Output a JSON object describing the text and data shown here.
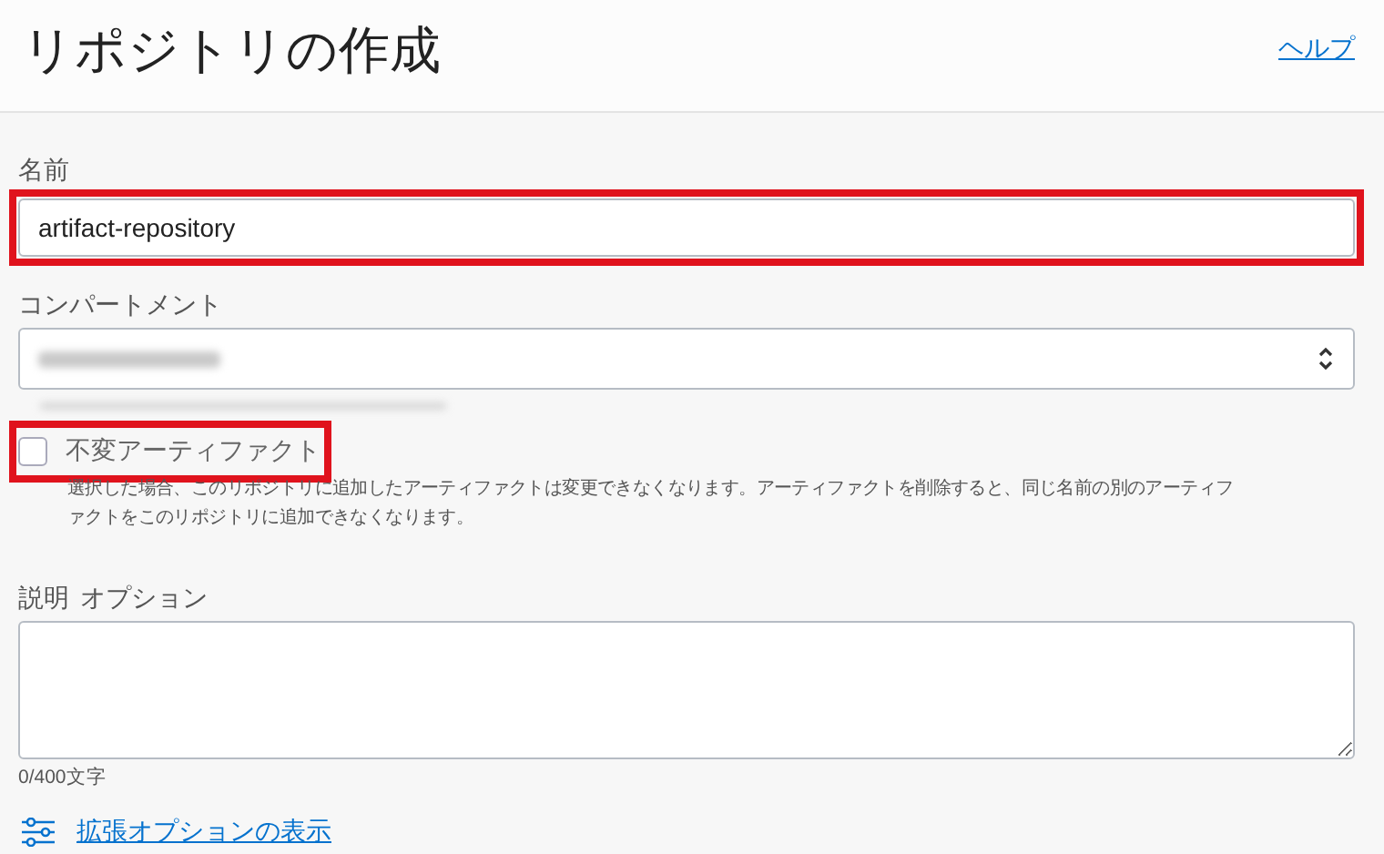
{
  "header": {
    "title": "リポジトリの作成",
    "help_link": "ヘルプ"
  },
  "name_field": {
    "label": "名前",
    "value": "artifact-repository",
    "highlighted": true
  },
  "compartment_field": {
    "label": "コンパートメント",
    "redacted": true
  },
  "immutable_option": {
    "label": "不変アーティファクト",
    "checked": false,
    "highlighted": true,
    "help_lines": [
      "選択した場合、このリポジトリに追加したアーティファクトは変更できなくなります。アーティファクトを削除すると、同じ名前の別のアーティフ",
      "ァクトをこのリポジトリに追加できなくなります。"
    ]
  },
  "description_field": {
    "label": "説明",
    "optional_label": "オプション",
    "counter": "0/400文字"
  },
  "advanced_link": {
    "label": "拡張オプションの表示"
  }
}
